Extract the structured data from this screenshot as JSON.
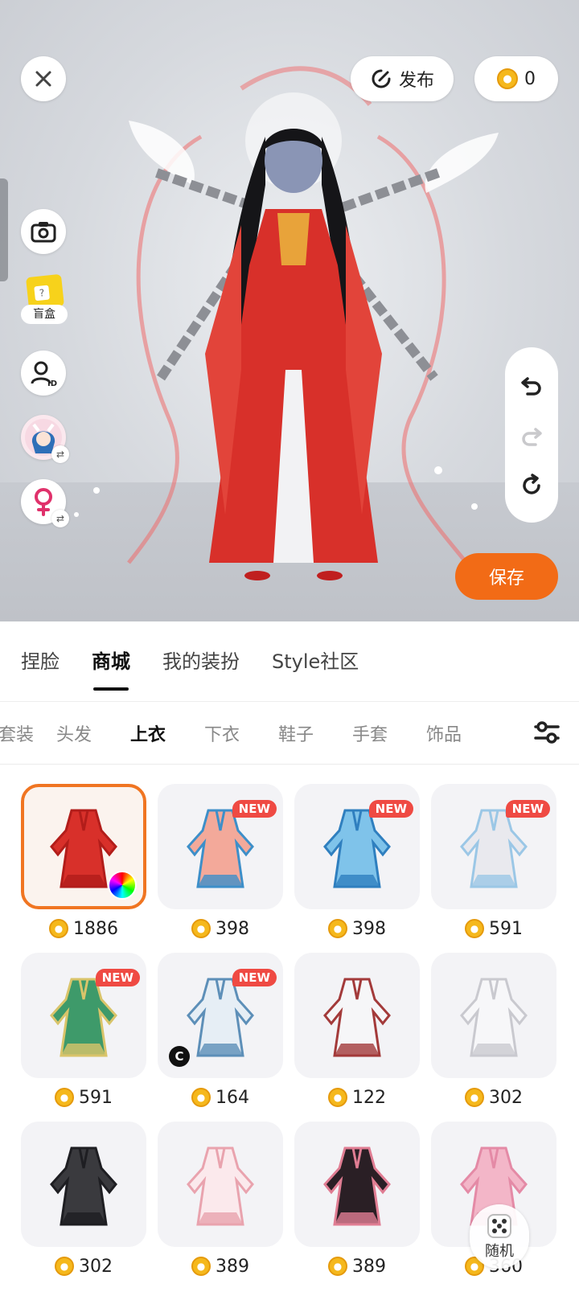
{
  "topbar": {
    "publish_label": "发布",
    "coin_balance": "0"
  },
  "left_tools": {
    "blindbox_label": "盲盒"
  },
  "save_label": "保存",
  "main_tabs": [
    {
      "label": "捏脸",
      "active": false
    },
    {
      "label": "商城",
      "active": true
    },
    {
      "label": "我的装扮",
      "active": false
    },
    {
      "label": "Style社区",
      "active": false
    }
  ],
  "category_tabs": [
    {
      "label": "套装",
      "active": false
    },
    {
      "label": "头发",
      "active": false
    },
    {
      "label": "上衣",
      "active": true
    },
    {
      "label": "下衣",
      "active": false
    },
    {
      "label": "鞋子",
      "active": false
    },
    {
      "label": "手套",
      "active": false
    },
    {
      "label": "饰品",
      "active": false
    }
  ],
  "new_badge": "NEW",
  "items": [
    {
      "price": "1886",
      "selected": true,
      "new": false,
      "color_picker": true,
      "palette": [
        "#d8302a",
        "#b21d1a"
      ],
      "icon": "red-dress-icon"
    },
    {
      "price": "398",
      "new": true,
      "palette": [
        "#f3a99a",
        "#3d8fc9"
      ],
      "icon": "pink-dress-icon"
    },
    {
      "price": "398",
      "new": true,
      "palette": [
        "#7fc3ea",
        "#2f7fbf"
      ],
      "icon": "blue-dress-icon"
    },
    {
      "price": "591",
      "new": true,
      "palette": [
        "#e9e9ee",
        "#9bc7e6"
      ],
      "icon": "white-sleeves-icon"
    },
    {
      "price": "591",
      "new": true,
      "palette": [
        "#3e9a6a",
        "#d9c46a"
      ],
      "icon": "green-bows-icon"
    },
    {
      "price": "164",
      "new": true,
      "c_badge": true,
      "palette": [
        "#e6eef5",
        "#5d8fb8"
      ],
      "icon": "tshirt-icon"
    },
    {
      "price": "122",
      "new": false,
      "palette": [
        "#f6f6f8",
        "#a33a3a"
      ],
      "icon": "white-jacket-icon"
    },
    {
      "price": "302",
      "new": false,
      "palette": [
        "#f7f7f9",
        "#c9c9cf"
      ],
      "icon": "white-coat-icon"
    },
    {
      "price": "302",
      "new": false,
      "palette": [
        "#3a3a3e",
        "#1e1e22"
      ],
      "icon": "black-coat-icon"
    },
    {
      "price": "389",
      "new": false,
      "palette": [
        "#fbe9ec",
        "#e9a3ae"
      ],
      "icon": "lace-dress-icon"
    },
    {
      "price": "389",
      "new": false,
      "palette": [
        "#2a1f25",
        "#e07d93"
      ],
      "icon": "gothic-dress-icon"
    },
    {
      "price": "360",
      "new": false,
      "palette": [
        "#f3b6c8",
        "#e48aa6"
      ],
      "icon": "pink-top-icon"
    }
  ],
  "random_label": "随机",
  "colors": {
    "accent": "#f26b16",
    "new_badge": "#ef4a43",
    "coin": "#f5b81c"
  }
}
